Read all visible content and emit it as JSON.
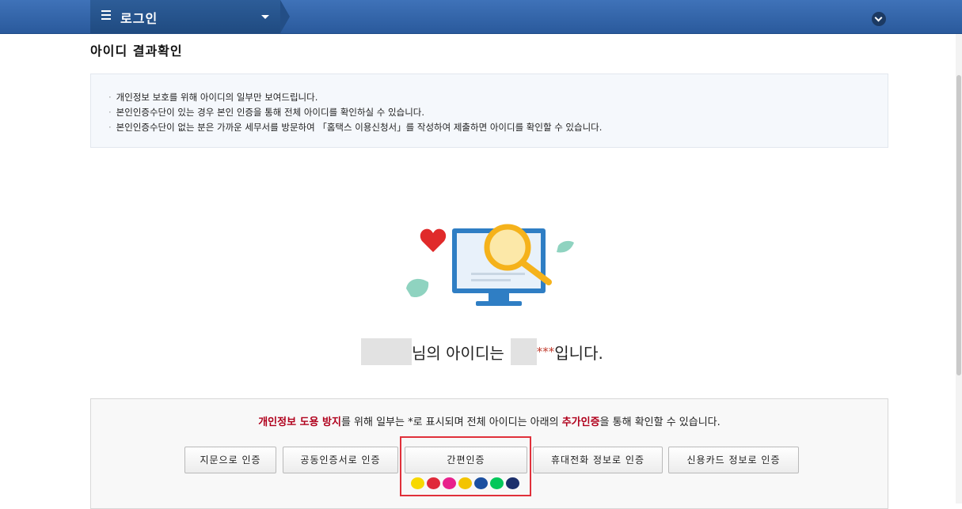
{
  "header": {
    "menu_title": "로그인"
  },
  "page": {
    "title": "아이디 결과확인"
  },
  "info": {
    "items": [
      "개인정보 보호를 위해 아이디의 일부만 보여드립니다.",
      "본인인증수단이 있는 경우 본인 인증을 통해 전체 아이디를 확인하실 수 있습니다.",
      "본인인증수단이 없는 분은 가까운 세무서를 방문하여 「홈택스 이용신청서」를 작성하여 제출하면 아이디를 확인할 수 있습니다."
    ]
  },
  "result": {
    "text_mid": "님의 아이디는",
    "masked": "***",
    "text_end": "입니다."
  },
  "verify": {
    "msg_red1": "개인정보 도용 방지",
    "msg_part2": "를 위해 일부는 *로 표시되며 전체 아이디는 아래의 ",
    "msg_red2": "추가인증",
    "msg_part3": "을 통해 확인할 수 있습니다.",
    "buttons": {
      "fingerprint": "지문으로 인증",
      "certificate": "공동인증서로 인증",
      "simple": "간편인증",
      "phone": "휴대전화 정보로 인증",
      "card": "신용카드 정보로 인증"
    },
    "provider_icons": [
      "kakao",
      "payco",
      "pass",
      "kb",
      "samsung-pass",
      "naver",
      "toss"
    ],
    "provider_colors": [
      "#f7d800",
      "#e02a3a",
      "#e8208c",
      "#f3c400",
      "#1b4fa0",
      "#03c75a",
      "#1b2f6b"
    ]
  },
  "colors": {
    "header": "#2a5a9c",
    "accent_red": "#b0001c",
    "highlight": "#e0303a"
  }
}
